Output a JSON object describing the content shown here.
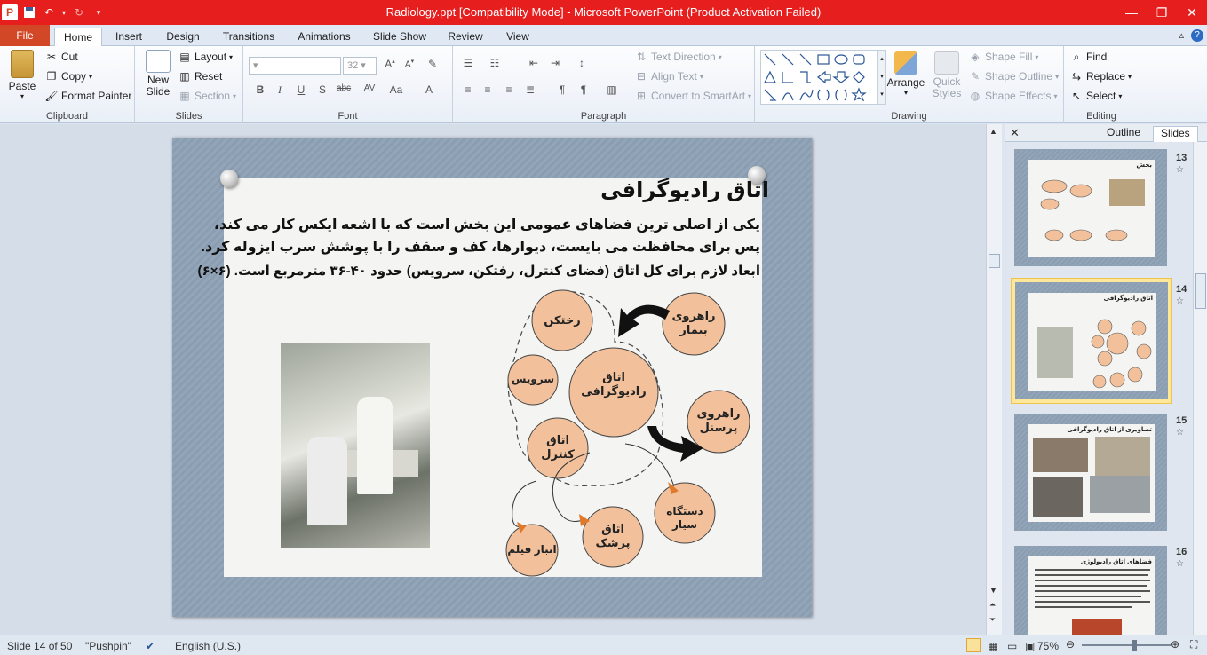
{
  "window": {
    "title": "Radiology.ppt [Compatibility Mode]  -  Microsoft PowerPoint (Product Activation Failed)",
    "app_icon": "P",
    "accent": "#e61e1e"
  },
  "tabs": [
    "File",
    "Home",
    "Insert",
    "Design",
    "Transitions",
    "Animations",
    "Slide Show",
    "Review",
    "View"
  ],
  "ribbon": {
    "clipboard": {
      "paste": "Paste",
      "cut": "Cut",
      "copy": "Copy",
      "format_painter": "Format Painter",
      "label": "Clipboard"
    },
    "slides": {
      "new_slide": "New Slide",
      "layout": "Layout",
      "reset": "Reset",
      "section": "Section",
      "label": "Slides"
    },
    "font": {
      "size": "32",
      "label": "Font"
    },
    "paragraph": {
      "text_direction": "Text Direction",
      "align_text": "Align Text",
      "convert_smartart": "Convert to SmartArt",
      "label": "Paragraph"
    },
    "drawing": {
      "arrange": "Arrange",
      "quick_styles": "Quick Styles",
      "shape_fill": "Shape Fill",
      "shape_outline": "Shape Outline",
      "shape_effects": "Shape Effects",
      "label": "Drawing"
    },
    "editing": {
      "find": "Find",
      "replace": "Replace",
      "select": "Select",
      "label": "Editing"
    }
  },
  "slide": {
    "title": "اتاق رادیوگرافی",
    "lines": [
      "یکی از اصلی ترین فضاهای عمومی این بخش است که با اشعه ایکس کار می کند،",
      "پس برای محافظت می بایست، دیوارها، کف و سقف را با پوشش سرب ایزوله کرد.",
      "ابعاد لازم برای کل اتاق (فضای کنترل، رفتکن، سرویس) حدود ۴۰-۳۶ مترمربع است. (۶×۶)"
    ],
    "circles": {
      "radiography": "اتاق رادیوگرافی",
      "dressing": "رختکن",
      "service": "سرویس",
      "control": "اتاق کنترل",
      "patient_corridor": "راهروی بیمار",
      "staff_corridor": "راهروی پرسنل",
      "portable": "دستگاه سیار",
      "doctor": "اتاق پزشک",
      "film": "انبار فیلم"
    },
    "circle_fill": "#f2c19c"
  },
  "pane": {
    "tab_outline": "Outline",
    "tab_slides": "Slides",
    "thumbs": [
      {
        "num": "13",
        "title": "بخش"
      },
      {
        "num": "14",
        "title": "اتاق رادیوگرافی"
      },
      {
        "num": "15",
        "title": "تصاویری از اتاق رادیوگرافی"
      },
      {
        "num": "16",
        "title": "فضاهای اتاق رادیولوژی"
      }
    ]
  },
  "status": {
    "slide_info": "Slide 14 of 50",
    "theme": "\"Pushpin\"",
    "language": "English (U.S.)",
    "zoom": "75%"
  }
}
